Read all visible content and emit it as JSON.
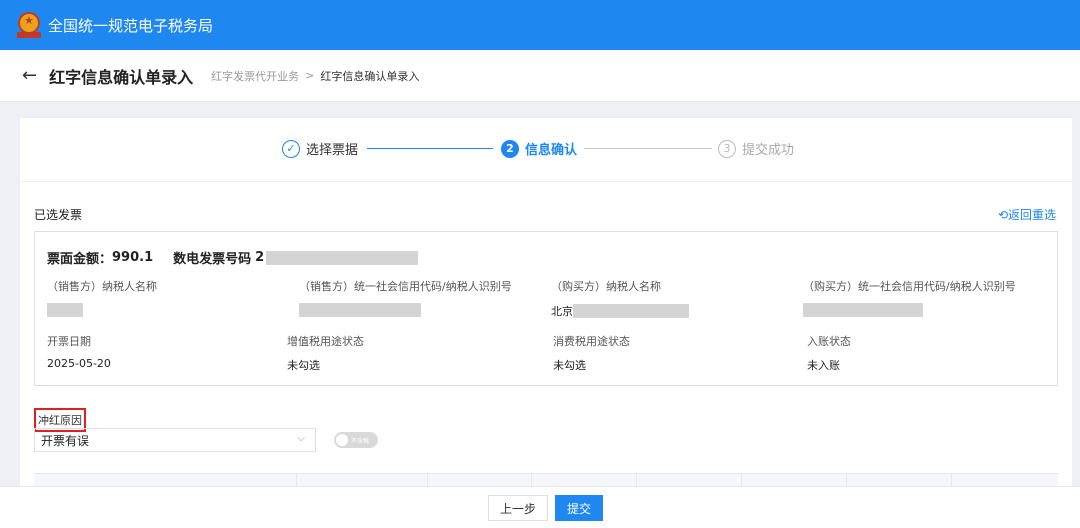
{
  "topbar": {
    "brand": "全国统一规范电子税务局"
  },
  "header": {
    "title": "红字信息确认单录入",
    "breadcrumb_parent": "红字发票代开业务",
    "breadcrumb_sep": ">",
    "breadcrumb_current": "红字信息确认单录入"
  },
  "steps": [
    {
      "index": "✓",
      "label": "选择票据",
      "state": "done"
    },
    {
      "index": "2",
      "label": "信息确认",
      "state": "active"
    },
    {
      "index": "3",
      "label": "提交成功",
      "state": "todo"
    }
  ],
  "section": {
    "title": "已选发票",
    "reselect": "⟲返回重选"
  },
  "invoice": {
    "amount_label": "票面金额：",
    "amount_value": "990.1",
    "number_label": "数电发票号码",
    "number_prefix": "2",
    "fields": [
      {
        "label": "（销售方）纳税人名称",
        "value": ""
      },
      {
        "label": "（销售方）统一社会信用代码/纳税人识别号",
        "value": ""
      },
      {
        "label": "（购买方）纳税人名称",
        "value": "北京"
      },
      {
        "label": "（购买方）统一社会信用代码/纳税人识别号",
        "value": ""
      },
      {
        "label": "开票日期",
        "value": "2025-05-20"
      },
      {
        "label": "增值税用途状态",
        "value": "未勾选"
      },
      {
        "label": "消费税用途状态",
        "value": "未勾选"
      },
      {
        "label": "入账状态",
        "value": "未入账"
      }
    ]
  },
  "reason": {
    "label": "冲红原因",
    "selected": "开票有误",
    "toggle_text": "不含税"
  },
  "footer": {
    "prev_label": "上一步",
    "submit_label": "提交"
  },
  "colors": {
    "primary": "#1e88f0",
    "highlight": "#e02020"
  }
}
